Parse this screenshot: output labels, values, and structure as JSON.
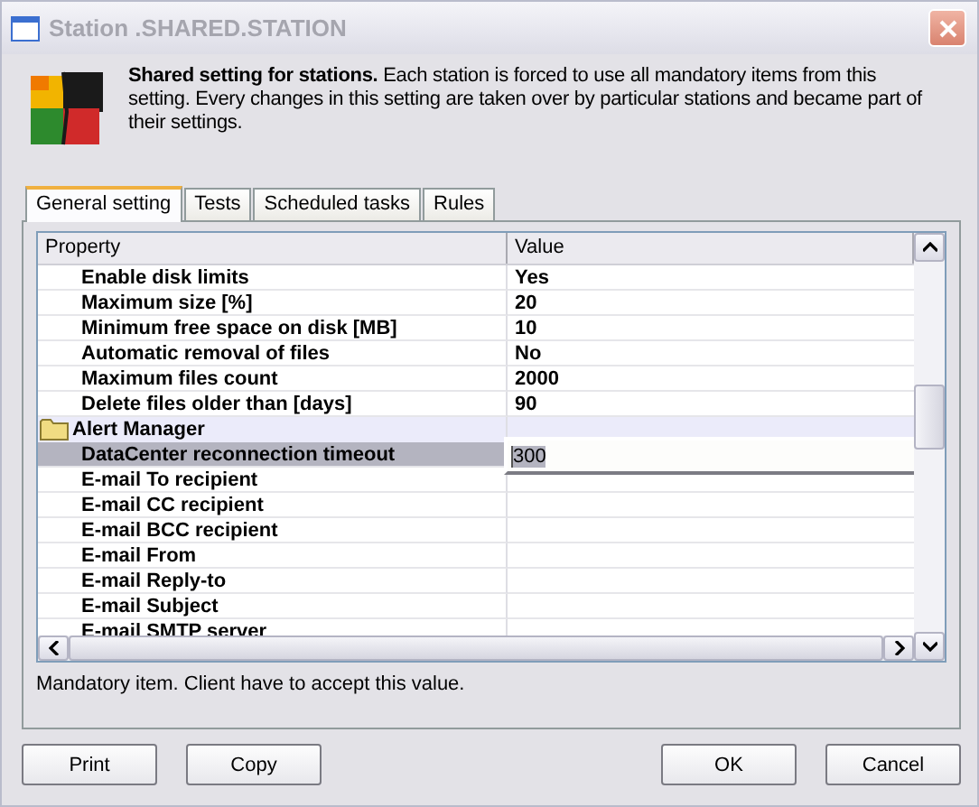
{
  "window": {
    "title": "Station .SHARED.STATION"
  },
  "header": {
    "text": "**Shared setting for stations.** Each station is forced to use all mandatory items from this setting. Every changes in this setting are taken over by particular stations and became part of their settings."
  },
  "tabs": [
    {
      "label": "General setting",
      "selected": true
    },
    {
      "label": "Tests",
      "selected": false
    },
    {
      "label": "Scheduled tasks",
      "selected": false
    },
    {
      "label": "Rules",
      "selected": false
    }
  ],
  "grid": {
    "columns": [
      "Property",
      "Value"
    ],
    "rows": [
      {
        "kind": "item",
        "property": "Enable disk limits",
        "value": "Yes",
        "selected": false
      },
      {
        "kind": "item",
        "property": "Maximum size [%]",
        "value": "20",
        "selected": false
      },
      {
        "kind": "item",
        "property": "Minimum free space on disk [MB]",
        "value": "10",
        "selected": false
      },
      {
        "kind": "item",
        "property": "Automatic removal of files",
        "value": "No",
        "selected": false
      },
      {
        "kind": "item",
        "property": "Maximum files count",
        "value": "2000",
        "selected": false
      },
      {
        "kind": "item",
        "property": "Delete files older than [days]",
        "value": "90",
        "selected": false
      },
      {
        "kind": "group",
        "property": "Alert Manager",
        "selected": false
      },
      {
        "kind": "item",
        "property": "DataCenter reconnection timeout",
        "value": "300",
        "selected": true
      },
      {
        "kind": "item",
        "property": "E-mail To recipient",
        "selected": false
      },
      {
        "kind": "item",
        "property": "E-mail CC recipient",
        "selected": false
      },
      {
        "kind": "item",
        "property": "E-mail BCC recipient",
        "selected": false
      },
      {
        "kind": "item",
        "property": "E-mail From",
        "selected": false
      },
      {
        "kind": "item",
        "property": "E-mail Reply-to",
        "selected": false
      },
      {
        "kind": "item",
        "property": "E-mail Subject",
        "selected": false
      },
      {
        "kind": "item",
        "property": "E-mail SMTP server",
        "selected": false
      }
    ]
  },
  "description": "Mandatory item. Client have to accept this value.",
  "buttons_left": [
    "Print",
    "Copy"
  ],
  "buttons_right": [
    "OK",
    "Cancel"
  ]
}
